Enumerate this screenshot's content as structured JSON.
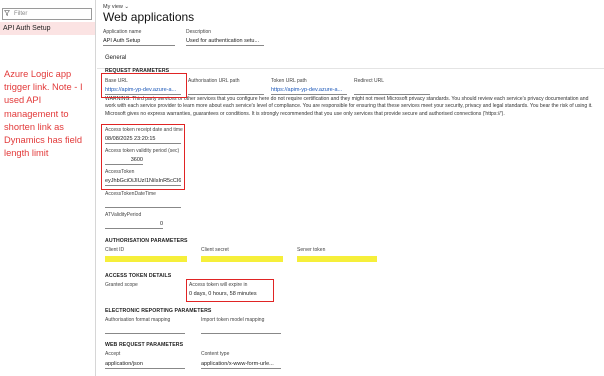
{
  "sidebar": {
    "filter_placeholder": "Filter",
    "item": "API Auth Setup",
    "note": "Azure Logic app trigger link. Note - I used API management to shorten link as Dynamics has field length limit"
  },
  "header": {
    "view": "My view",
    "view_chevron": "⌄",
    "title": "Web applications"
  },
  "app": {
    "name_label": "Application name",
    "name_value": "API Auth Setup",
    "desc_label": "Description",
    "desc_value": "Used for authentication setu..."
  },
  "general": {
    "tab": "General",
    "request_title": "REQUEST PARAMETERS",
    "base_url_label": "Base URL",
    "base_url_value": "https://apim-yp-dev.azure-a...",
    "auth_url_label": "Authorisation URL path",
    "token_url_label": "Token URL path",
    "token_url_value": "https://apim-yp-dev.azure-a...",
    "redirect_label": "Redirect URL",
    "warning": "WARNING: Third party services or other services that you configure here do not require certification and they might not meet Microsoft privacy standards. You should review each service's privacy documentation and work with each service provider to learn more about each service's level of compliance. You are responsible for ensuring that these services meet your security, privacy and legal standards. You bear the risk of using it. Microsoft gives no express warranties, guarantees or conditions. It is strongly recommended that you use only services that provide secure and authorised connections ('https://').",
    "receipt_label": "Access token receipt date and time",
    "receipt_value": "08/08/2025 23:20:15",
    "validity_label": "Access token validity period (sec)",
    "validity_value": "3600",
    "access_token_label": "AccessToken",
    "access_token_value": "eyJhbGciOiJIUzI1NiIsInR5cCI6...",
    "token_datetime_label": "AccessTokenDateTime",
    "validity_period_label": "ATValidityPeriod",
    "validity_period_value": "0"
  },
  "auth": {
    "title": "AUTHORISATION PARAMETERS",
    "client_id_label": "Client ID",
    "client_secret_label": "Client secret",
    "server_token_label": "Server token"
  },
  "details": {
    "title": "ACCESS TOKEN DETAILS",
    "granted_label": "Granted scope",
    "expire_label": "Access token will expire in",
    "expire_value": "0 days, 0 hours, 58 minutes"
  },
  "er": {
    "title": "ELECTRONIC REPORTING PARAMETERS",
    "auth_mapping_label": "Authorisation format mapping",
    "import_mapping_label": "Import token model mapping"
  },
  "web": {
    "title": "WEB REQUEST PARAMETERS",
    "accept_label": "Accept",
    "accept_value": "application/json",
    "content_label": "Content type",
    "content_value": "application/x-www-form-urle..."
  },
  "colors": {
    "highlight": "#f6ef3a",
    "annotation": "#e02424",
    "selected": "#fbe3e3",
    "link": "#1a56b8"
  }
}
